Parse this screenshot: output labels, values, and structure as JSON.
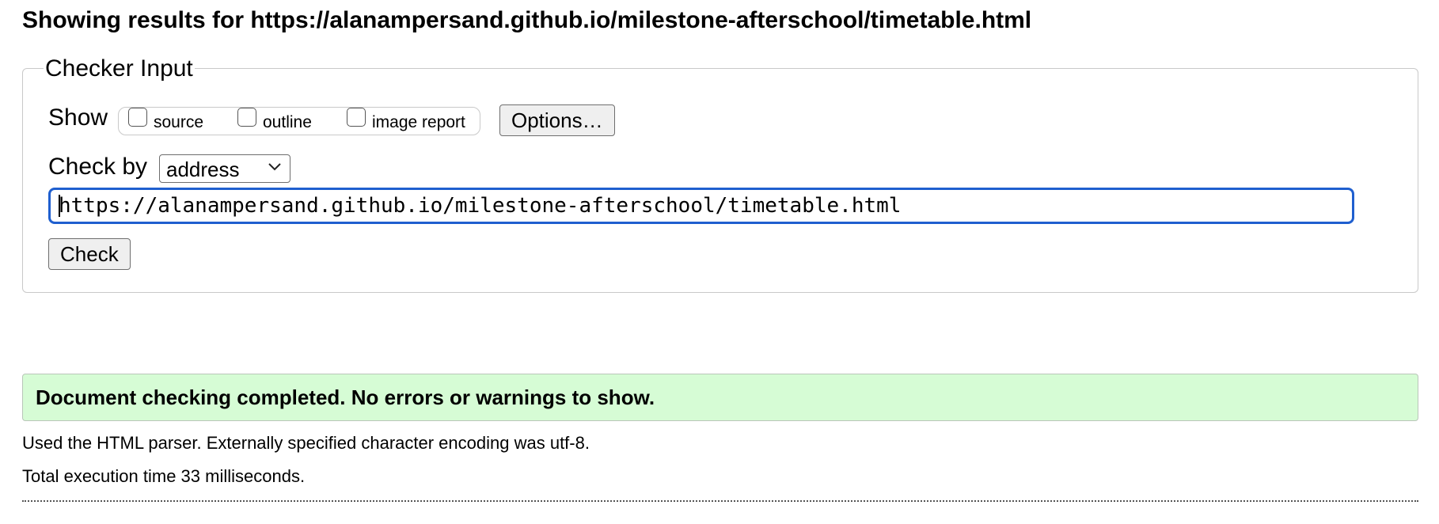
{
  "page_title": "Showing results for https://alanampersand.github.io/milestone-afterschool/timetable.html",
  "checker": {
    "legend": "Checker Input",
    "show_label": "Show",
    "show_options": [
      {
        "label": "source",
        "checked": false
      },
      {
        "label": "outline",
        "checked": false
      },
      {
        "label": "image report",
        "checked": false
      }
    ],
    "options_button": "Options…",
    "check_by_label": "Check by",
    "check_by_value": "address",
    "url_value": "https://alanampersand.github.io/milestone-afterschool/timetable.html",
    "check_button": "Check"
  },
  "result": {
    "message": "Document checking completed. No errors or warnings to show.",
    "parser_info": "Used the HTML parser. Externally specified character encoding was utf-8.",
    "execution_time": "Total execution time 33 milliseconds."
  },
  "colors": {
    "success_bg": "#d6fcd5",
    "focus_border": "#1f5fcf"
  },
  "icons": {
    "select_chevron": "chevron-down-icon"
  }
}
